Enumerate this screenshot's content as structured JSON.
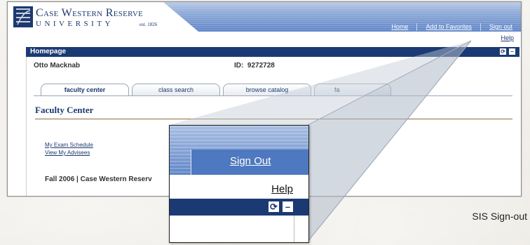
{
  "header": {
    "logo_line1": "Case Western Reserve",
    "logo_line2": "UNIVERSITY",
    "logo_est": "est. 1826",
    "nav": [
      "Home",
      "Add to Favorites",
      "Sign out"
    ],
    "help": "Help"
  },
  "panel": {
    "title": "Homepage",
    "refresh_icon": "refresh-icon",
    "minimize_icon": "minimize-icon"
  },
  "user": {
    "name": "Otto Macknab",
    "id_label": "ID:",
    "id_value": "9272728"
  },
  "tabs": [
    {
      "label": "faculty center",
      "active": true
    },
    {
      "label": "class search",
      "active": false
    },
    {
      "label": "browse catalog",
      "active": false
    },
    {
      "label": "fa",
      "active": false
    }
  ],
  "main": {
    "section_title": "Faculty Center",
    "links": [
      "My Exam Schedule",
      "View My Advisees"
    ],
    "term_text": "Fall 2006 | Case Western Reserv"
  },
  "zoom": {
    "signout": "Sign Out",
    "help": "Help"
  },
  "caption": "SIS Sign-out",
  "colors": {
    "navy": "#1b3a74",
    "nav_blue": "#5f85c8"
  }
}
